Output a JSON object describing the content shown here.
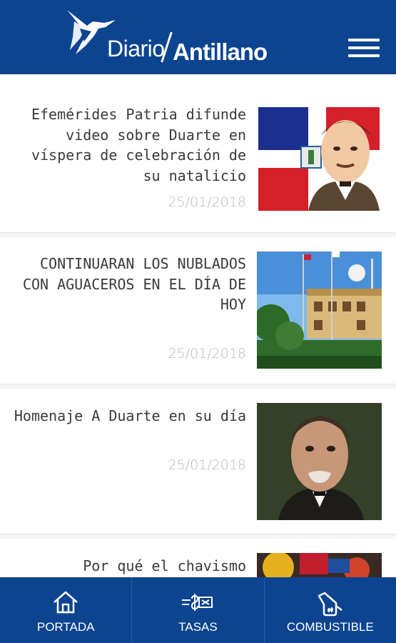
{
  "app": {
    "logo_light": "Diario",
    "logo_bold": "Antillano"
  },
  "articles": [
    {
      "title": "Efemérides Patria difunde video sobre Duarte en víspera de celebración de su natalicio",
      "date": "25/01/2018"
    },
    {
      "title": "CONTINUARAN LOS NUBLADOS CON AGUACEROS EN EL DÍA DE HOY",
      "date": "25/01/2018"
    },
    {
      "title": "Homenaje A Duarte en su día",
      "date": "25/01/2018"
    },
    {
      "title": "Por qué el chavismo",
      "date": ""
    }
  ],
  "nav": {
    "portada": "PORTADA",
    "tasas": "TASAS",
    "combustible": "COMBUSTIBLE"
  },
  "colors": {
    "brand": "#0d4490",
    "date": "#b9b9b9",
    "title": "#3a3a3a"
  }
}
